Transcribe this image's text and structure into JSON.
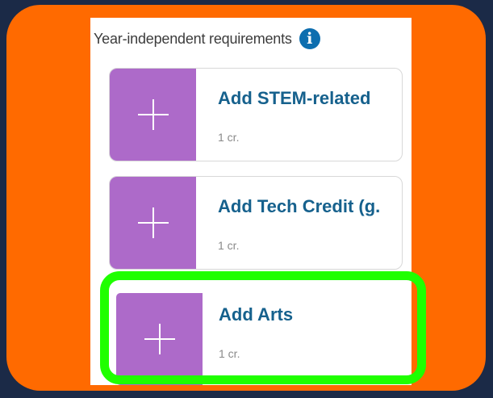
{
  "section": {
    "title": "Year-independent requirements",
    "info_icon": "info-icon"
  },
  "cards": [
    {
      "title": "Add STEM-related",
      "credits": "1 cr.",
      "icon": "plus-icon"
    },
    {
      "title": "Add Tech Credit (g.",
      "credits": "1 cr.",
      "icon": "plus-icon"
    },
    {
      "title": "Add Arts",
      "credits": "1 cr.",
      "icon": "plus-icon"
    }
  ],
  "colors": {
    "background": "#1b2a47",
    "frame": "#ff6a00",
    "add_tile": "#ad6ac9",
    "card_title": "#16618d",
    "info_icon": "#0d6eaf",
    "highlight": "#1fff00"
  }
}
